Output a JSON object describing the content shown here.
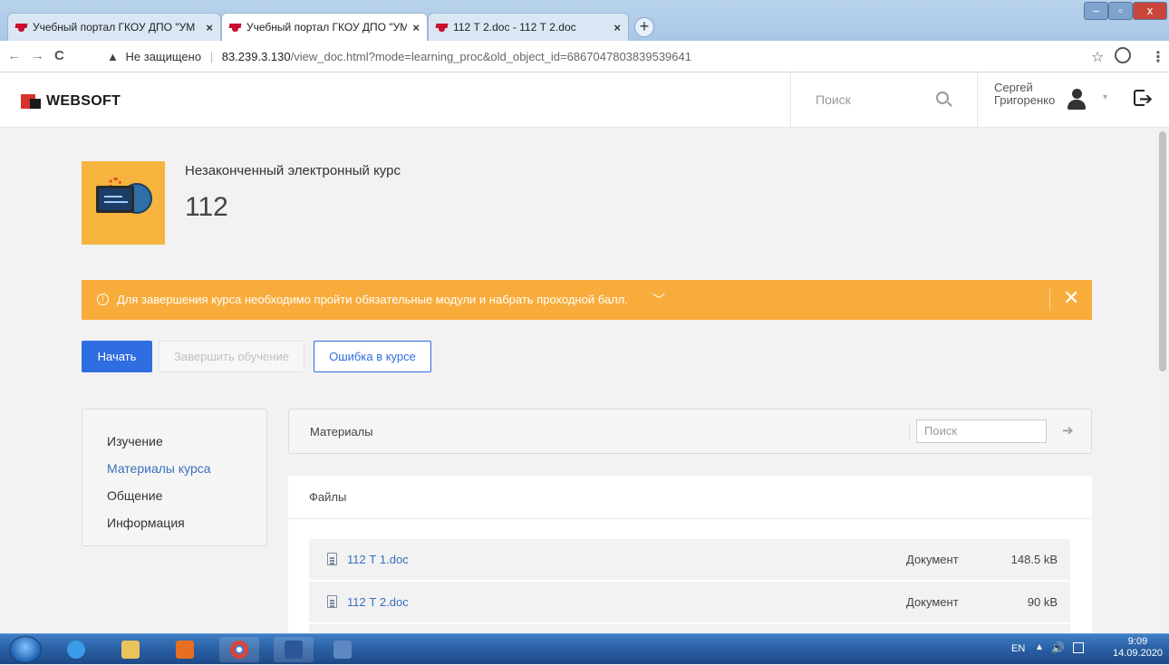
{
  "browser": {
    "tabs": [
      {
        "title": "Учебный портал ГКОУ ДПО \"УМ",
        "active": false
      },
      {
        "title": "Учебный портал ГКОУ ДПО \"УМ",
        "active": true
      },
      {
        "title": "112 Т 2.doc - 112 Т 2.doc",
        "active": false
      }
    ],
    "close_glyph": "×",
    "newtab_glyph": "+",
    "nav": {
      "back": "←",
      "forward": "→",
      "reload": "C"
    },
    "address": {
      "security_label": "Не защищено",
      "security_icon": "warning-icon",
      "host": "83.239.3.130",
      "path": "/view_doc.html?mode=learning_proc&old_object_id=6867047803839539641"
    },
    "star_glyph": "☆",
    "menu_glyph": "⋮"
  },
  "site": {
    "logo_text": "WEBSOFT",
    "search_placeholder": "Поиск",
    "user_first_name": "Сергей",
    "user_last_name": "Григоренко",
    "caret": "▾",
    "logout_arrow": "➔"
  },
  "course": {
    "subtitle": "Незаконченный электронный курс",
    "title": "112"
  },
  "alert": {
    "icon_glyph": "!",
    "message": "Для завершения курса необходимо пройти обязательные модули и набрать проходной балл.",
    "chevron": "﹀",
    "close": "✕",
    "color": "#f8ac3b"
  },
  "actions": {
    "start": "Начать",
    "finish": "Завершить обучение",
    "report_error": "Ошибка в курсе"
  },
  "menu": {
    "items": [
      {
        "label": "Изучение",
        "selected": false
      },
      {
        "label": "Материалы курса",
        "selected": true
      },
      {
        "label": "Общение",
        "selected": false
      },
      {
        "label": "Информация",
        "selected": false
      }
    ]
  },
  "materials": {
    "label": "Материалы",
    "search_placeholder": "Поиск",
    "go_glyph": "➔",
    "files_header": "Файлы",
    "files": [
      {
        "name": "112 Т 1.doc",
        "type": "Документ",
        "size": "148.5 kB"
      },
      {
        "name": "112 Т 2.doc",
        "type": "Документ",
        "size": "90 kB"
      }
    ]
  },
  "taskbar": {
    "lang": "EN",
    "tray_arrow": "▲",
    "volume": "🔊",
    "time": "9:09",
    "date": "14.09.2020"
  },
  "colors": {
    "accent": "#2f6ee0",
    "link": "#3a6fbe",
    "brand_red": "#d7322b"
  }
}
